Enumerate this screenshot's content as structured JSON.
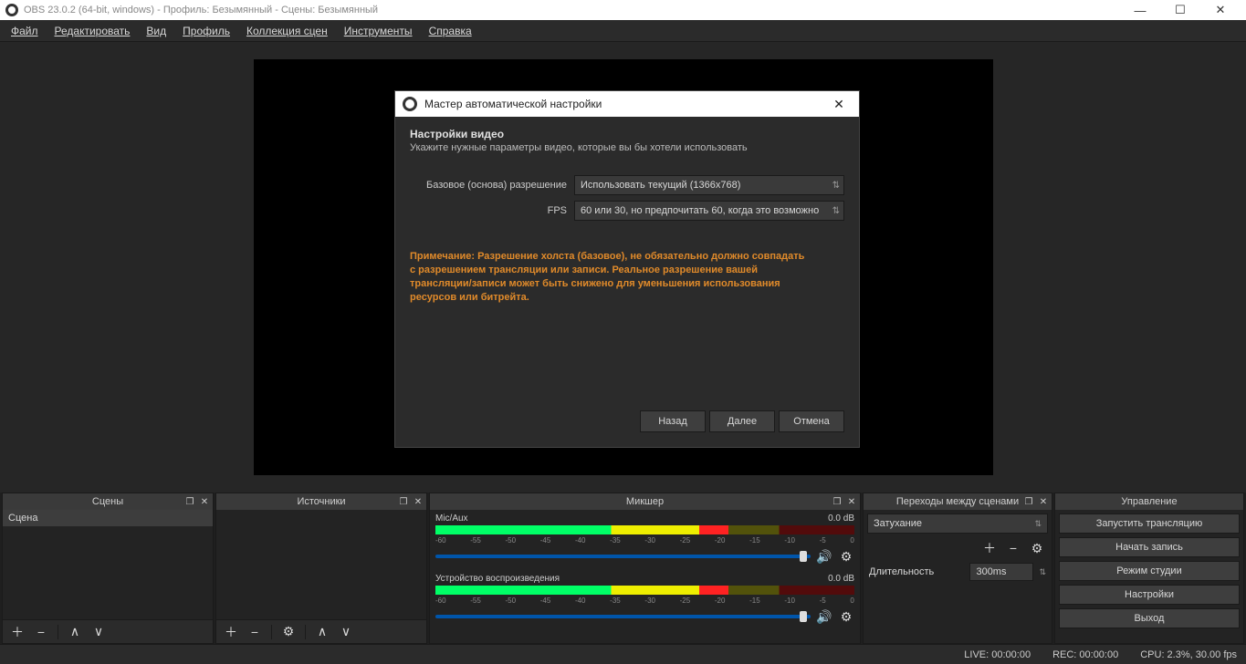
{
  "window": {
    "title": "OBS 23.0.2 (64-bit, windows) - Профиль: Безымянный - Сцены: Безымянный"
  },
  "menubar": {
    "file": "Файл",
    "edit": "Редактировать",
    "view": "Вид",
    "profile": "Профиль",
    "scene_collection": "Коллекция сцен",
    "tools": "Инструменты",
    "help": "Справка"
  },
  "docks": {
    "scenes_title": "Сцены",
    "sources_title": "Источники",
    "mixer_title": "Микшер",
    "transitions_title": "Переходы между сценами",
    "controls_title": "Управление"
  },
  "scenes": {
    "items": [
      "Сцена"
    ]
  },
  "mixer": {
    "channels": [
      {
        "name": "Mic/Aux",
        "db": "0.0 dB"
      },
      {
        "name": "Устройство воспроизведения",
        "db": "0.0 dB"
      }
    ],
    "ticks": [
      "-60",
      "-55",
      "-50",
      "-45",
      "-40",
      "-35",
      "-30",
      "-25",
      "-20",
      "-15",
      "-10",
      "-5",
      "0"
    ]
  },
  "transitions": {
    "selected": "Затухание",
    "duration_label": "Длительность",
    "duration_value": "300ms"
  },
  "controls": {
    "start_stream": "Запустить трансляцию",
    "start_record": "Начать запись",
    "studio_mode": "Режим студии",
    "settings": "Настройки",
    "exit": "Выход"
  },
  "statusbar": {
    "live": "LIVE: 00:00:00",
    "rec": "REC: 00:00:00",
    "cpu": "CPU: 2.3%, 30.00 fps"
  },
  "modal": {
    "title": "Мастер автоматической настройки",
    "heading": "Настройки видео",
    "subheading": "Укажите нужные параметры видео, которые вы бы хотели использовать",
    "base_res_label": "Базовое (основа) разрешение",
    "base_res_value": "Использовать текущий (1366x768)",
    "fps_label": "FPS",
    "fps_value": "60 или 30, но предпочитать 60, когда это возможно",
    "note": "Примечание: Разрешение холста (базовое), не обязательно должно совпадать с разрешением трансляции или записи. Реальное разрешение вашей трансляции/записи может быть снижено для уменьшения использования ресурсов или битрейта.",
    "back": "Назад",
    "next": "Далее",
    "cancel": "Отмена"
  }
}
